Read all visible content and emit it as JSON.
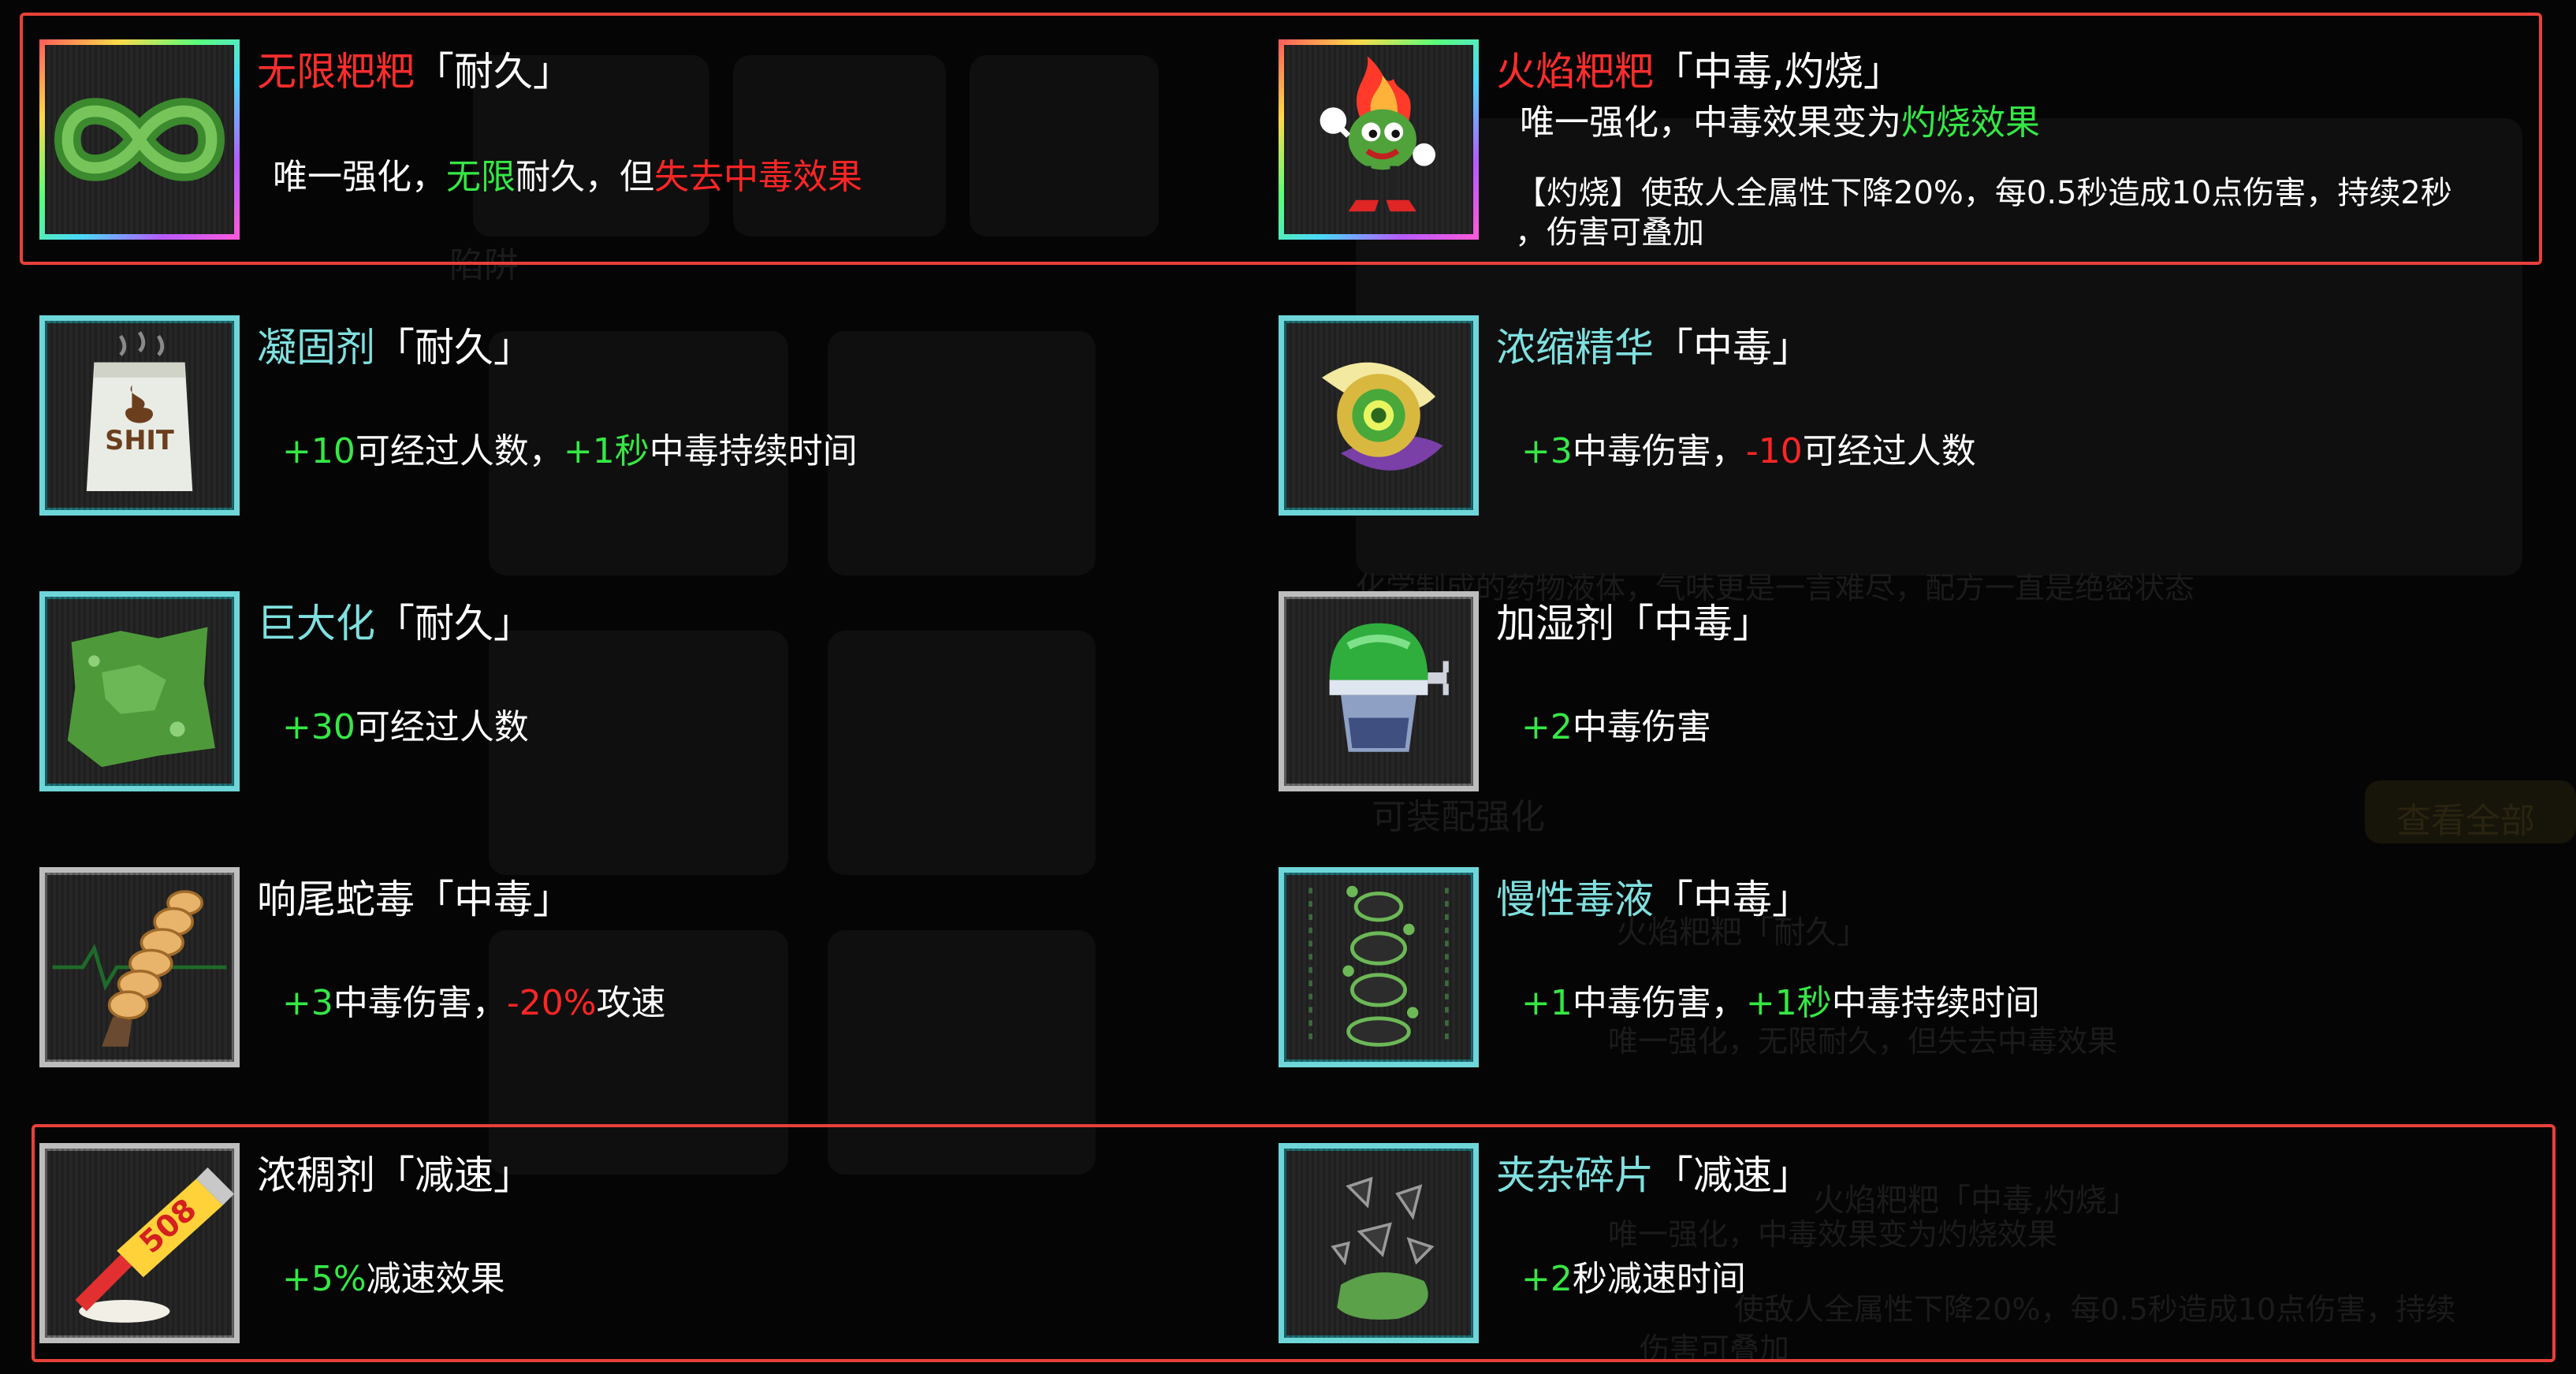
{
  "colors": {
    "positive": "#35e845",
    "negative": "#ff2525",
    "title_red": "#ff2d2d",
    "title_cyan": "#7fe0df",
    "highlight_border": "#e8403a"
  },
  "items": [
    {
      "name": "无限粑粑",
      "tags": "「耐久」",
      "icon": "infinity-icon",
      "desc": {
        "a": "唯一强化，",
        "b": "无限",
        "c": "耐久，但",
        "d": "失去中毒效果"
      }
    },
    {
      "name": "火焰粑粑",
      "tags": "「中毒,灼烧」",
      "icon": "flame-poop-icon",
      "desc": {
        "a": "唯一强化，中毒效果变为",
        "b": "灼烧效果"
      },
      "detail_line1": "【灼烧】使敌人全属性下降20%，每0.5秒造成10点伤害，持续2秒",
      "detail_line2": "，伤害可叠加"
    },
    {
      "name": "凝固剂",
      "tags": "「耐久」",
      "icon": "bag-icon",
      "desc": {
        "a": "+10",
        "b": "可经过人数，",
        "c": "+1秒",
        "d": "中毒持续时间"
      }
    },
    {
      "name": "浓缩精华",
      "tags": "「中毒」",
      "icon": "essence-icon",
      "desc": {
        "a": "+3",
        "b": "中毒伤害，",
        "c": "-10",
        "d": "可经过人数"
      }
    },
    {
      "name": "巨大化",
      "tags": "「耐久」",
      "icon": "slime-icon",
      "desc": {
        "a": "+30",
        "b": "可经过人数"
      }
    },
    {
      "name": "加湿剂",
      "tags": "「中毒」",
      "icon": "humidifier-icon",
      "desc": {
        "a": "+2",
        "b": "中毒伤害"
      }
    },
    {
      "name": "响尾蛇毒",
      "tags": "「中毒」",
      "icon": "rattlesnake-icon",
      "desc": {
        "a": "+3",
        "b": "中毒伤害，",
        "c": "-20%",
        "d": "攻速"
      }
    },
    {
      "name": "慢性毒液",
      "tags": "「中毒」",
      "icon": "venom-icon",
      "desc": {
        "a": "+1",
        "b": "中毒伤害，",
        "c": "+1秒",
        "d": "中毒持续时间"
      }
    },
    {
      "name": "浓稠剂",
      "tags": "「减速」",
      "icon": "glue-tube-icon",
      "icon_label": "508",
      "desc": {
        "a": "+5%",
        "b": "减速效果"
      }
    },
    {
      "name": "夹杂碎片",
      "tags": "「减速」",
      "icon": "shards-icon",
      "desc": {
        "a": "+2",
        "b": "秒减速时间"
      }
    }
  ],
  "background": {
    "faint_labels": [
      "陷阱",
      "可装配强化",
      "查看全部",
      "火焰粑粑「耐久」",
      "唯一强化，无限耐久，但失去中毒效果",
      "火焰粑粑「中毒,灼烧」",
      "唯一强化，中毒效果变为灼烧效果",
      "使敌人全属性下降20%，每0.5秒造成10点伤害，持续",
      "伤害可叠加",
      "化学制成的药物液体，气味更是一言难尽，配方一直是绝密状态"
    ]
  }
}
